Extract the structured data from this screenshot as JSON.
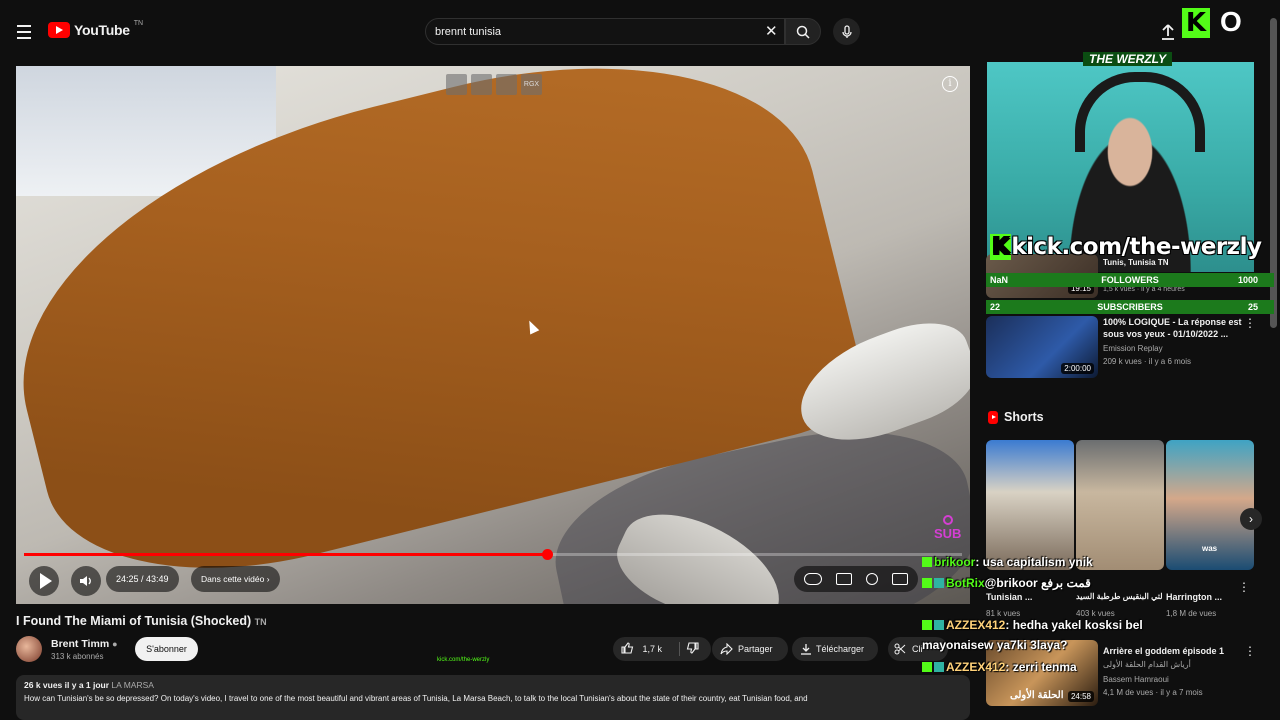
{
  "header": {
    "logo_text": "YouTube",
    "logo_region": "TN",
    "search_value": "brennt tunisia",
    "clear_glyph": "✕",
    "kick_glyph": "K",
    "corner_glyph": "O"
  },
  "player": {
    "time": "24:25 / 43:49",
    "chapter_label": "Dans cette vidéo",
    "progress_fraction": 0.5573,
    "overlay_buttons": [
      "",
      "",
      "",
      "RGX"
    ],
    "sub_badge": "SUB"
  },
  "video": {
    "title": "I Found The Miami of Tunisia (Shocked)",
    "title_suffix": "TN",
    "channel": "Brent Timm",
    "subscribers": "313 k abonnés",
    "subscribe_label": "S'abonner",
    "likes": "1,7 k",
    "share_label": "Partager",
    "download_label": "Télécharger",
    "clip_label": "Cli",
    "kick_tiny": "kick.com/the-werzly",
    "views_date": "26 k vues  il y a 1 jour",
    "location": "LA MARSA",
    "description": "How can Tunisian's be so depressed? On today's video, I travel to one of the most beautiful and vibrant areas of Tunisia, La Marsa Beach, to talk to the local Tunisian's about the state of their country, eat Tunisian food, and"
  },
  "stream_overlay": {
    "streamer_title": "THE WERZLY",
    "kick_prefix": "K",
    "kick_url": "kick.com/the-werzly",
    "followers": {
      "left": "NaN",
      "label": "FOLLOWERS",
      "right": "1000"
    },
    "subscribers": {
      "left": "22",
      "label": "SUBSCRIBERS",
      "right": "25"
    }
  },
  "sidebar": {
    "partial_item": {
      "title": "Tunis, Tunisia",
      "suffix": "TN",
      "meta": "1,5 k vues · il y a 4 heures",
      "duration": "19:15"
    },
    "item": {
      "title": "100% LOGIQUE - La réponse est sous vos yeux - 01/10/2022 ...",
      "channel": "Emission Replay",
      "meta": "209 k vues · il y a 6 mois",
      "duration": "2:00:00"
    },
    "shorts_label": "Shorts",
    "shorts": [
      {
        "title": "Tunisian ...",
        "views": "81 k vues"
      },
      {
        "title": "ستراك التي البنقيس طرطبة السيد ...",
        "views": "403 k vues"
      },
      {
        "title": "Harrington ...",
        "views": "1,8 M de vues",
        "overlay": "was"
      }
    ],
    "bottom_item": {
      "title": "Arrière el goddem épisode 1",
      "subtitle": "أرياش القدام الحلقة الأولى",
      "channel": "Bassem Hamraoui",
      "meta": "4,1 M de vues · il y a 7 mois",
      "thumb_text": "الحلقة الأولى",
      "duration": "24:58"
    }
  },
  "chat": [
    {
      "user": "brikoor",
      "text": ": usa capitalism ynik"
    },
    {
      "user": "BotRix",
      "text": "@brikoor قمت برفع"
    },
    {
      "user": "AZZEX412",
      "text": ": hedha yakel kosksi bel"
    },
    {
      "user": "",
      "text": "mayonaisew ya7ki 3laya?"
    },
    {
      "user": "AZZEX412",
      "text": ": zerri tenma"
    }
  ],
  "colors": {
    "accent": "#ff0000",
    "kick_green": "#53fc18",
    "stat_bar": "#1c7a1c",
    "background": "#0f0f0f"
  }
}
